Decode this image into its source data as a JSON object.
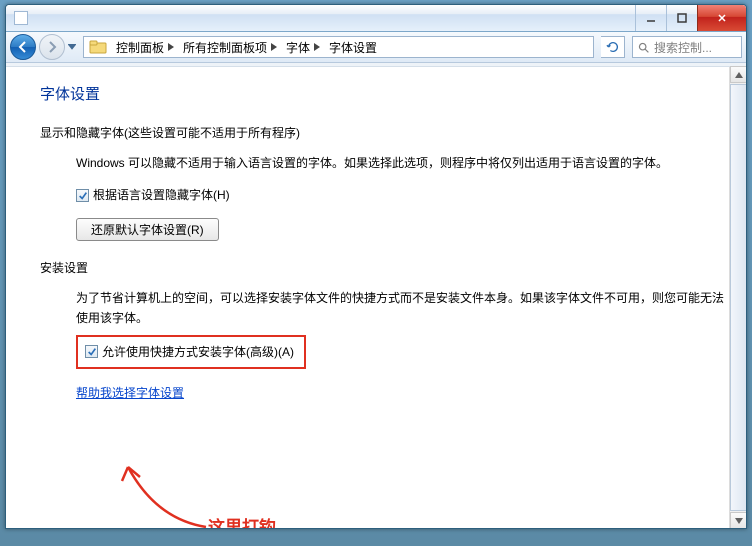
{
  "breadcrumbs": [
    "控制面板",
    "所有控制面板项",
    "字体",
    "字体设置"
  ],
  "search_placeholder": "搜索控制...",
  "page_title": "字体设置",
  "section1": {
    "title": "显示和隐藏字体(这些设置可能不适用于所有程序)",
    "text": "Windows 可以隐藏不适用于输入语言设置的字体。如果选择此选项，则程序中将仅列出适用于语言设置的字体。",
    "checkbox_label": "根据语言设置隐藏字体(H)",
    "checkbox_checked": true,
    "button_label": "还原默认字体设置(R)"
  },
  "section2": {
    "title": "安装设置",
    "text": "为了节省计算机上的空间，可以选择安装字体文件的快捷方式而不是安装文件本身。如果该字体文件不可用，则您可能无法使用该字体。",
    "checkbox_label": "允许使用快捷方式安装字体(高级)(A)",
    "checkbox_checked": true
  },
  "help_link": "帮助我选择字体设置",
  "annotation": "这里打钩"
}
